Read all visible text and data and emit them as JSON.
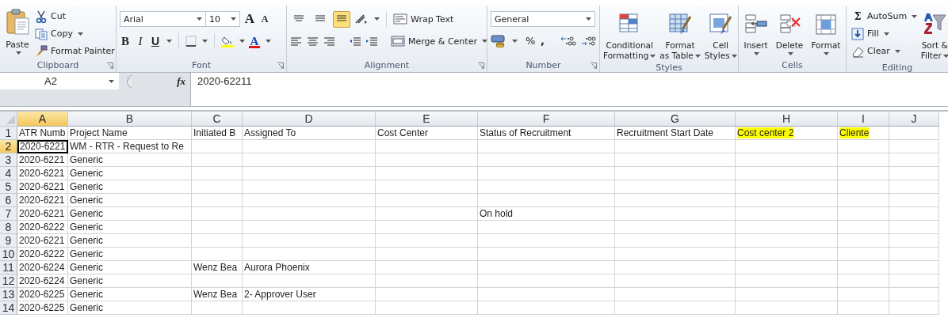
{
  "ribbon": {
    "groups": [
      {
        "kind": "clipboard",
        "label": "Clipboard",
        "launcher": true,
        "paste": "Paste",
        "items": [
          {
            "label": "Cut",
            "dropdown": false
          },
          {
            "label": "Copy",
            "dropdown": true
          },
          {
            "label": "Format Painter",
            "dropdown": false
          }
        ]
      },
      {
        "kind": "font",
        "label": "Font",
        "launcher": true,
        "font_name": "Arial",
        "font_size": "10",
        "grow": "A",
        "shrink": "A",
        "bold": "B",
        "italic": "I",
        "underline": "U",
        "font_color": "A"
      },
      {
        "kind": "alignment",
        "label": "Alignment",
        "launcher": true,
        "top": [
          {
            "selected": false
          },
          {
            "selected": false
          },
          {
            "selected": true
          }
        ],
        "wrap": "Wrap Text",
        "merge": "Merge & Center"
      },
      {
        "kind": "number",
        "label": "Number",
        "launcher": true,
        "format": "General",
        "percent": "%",
        "comma": ","
      },
      {
        "kind": "large",
        "label": "Styles",
        "launcher": false,
        "buttons": [
          {
            "lines": [
              "Conditional",
              "Formatting"
            ],
            "dropdown": true
          },
          {
            "lines": [
              "Format",
              "as Table"
            ],
            "dropdown": true
          },
          {
            "lines": [
              "Cell",
              "Styles"
            ],
            "dropdown": true
          }
        ]
      },
      {
        "kind": "large",
        "label": "Cells",
        "launcher": false,
        "buttons": [
          {
            "lines": [
              "Insert"
            ],
            "dropdown": true
          },
          {
            "lines": [
              "Delete"
            ],
            "dropdown": true
          },
          {
            "lines": [
              "Format"
            ],
            "dropdown": true
          }
        ]
      },
      {
        "kind": "editing",
        "label": "Editing",
        "launcher": false,
        "sigma": "Σ",
        "items": [
          {
            "label": "AutoSum",
            "dropdown": true
          },
          {
            "label": "Fill",
            "dropdown": true
          },
          {
            "label": "Clear",
            "dropdown": true
          }
        ],
        "sort": [
          "Sort &",
          "Filter"
        ]
      }
    ]
  },
  "formula_bar": {
    "name_box": "A2",
    "fx": "fx",
    "formula": "2020-62211"
  },
  "sheet": {
    "columns": [
      {
        "label": "A",
        "selected": true
      },
      {
        "label": "B",
        "selected": false
      },
      {
        "label": "C",
        "selected": false
      },
      {
        "label": "D",
        "selected": false
      },
      {
        "label": "E",
        "selected": false
      },
      {
        "label": "F",
        "selected": false
      },
      {
        "label": "G",
        "selected": false
      },
      {
        "label": "H",
        "selected": false
      },
      {
        "label": "I",
        "selected": false
      },
      {
        "label": "J",
        "selected": false
      }
    ],
    "rows": [
      {
        "number": "1",
        "selected": false,
        "cells": {
          "A": {
            "text": "ATR Numb",
            "highlighted": false
          },
          "B": {
            "text": "Project Name",
            "highlighted": false
          },
          "C": {
            "text": "Initiated B",
            "highlighted": false
          },
          "D": {
            "text": "Assigned To",
            "highlighted": false
          },
          "E": {
            "text": "Cost Center",
            "highlighted": false
          },
          "F": {
            "text": "Status of Recruitment",
            "highlighted": false
          },
          "G": {
            "text": "Recruitment Start Date",
            "highlighted": false
          },
          "H": {
            "text": "Cost center 2",
            "highlighted": true
          },
          "I": {
            "text": "Cliente",
            "highlighted": true
          }
        }
      },
      {
        "number": "2",
        "selected": true,
        "cells": {
          "A": {
            "text": "2020-6221"
          },
          "B": {
            "text": "WM - RTR - Request to Re"
          }
        }
      },
      {
        "number": "3",
        "selected": false,
        "cells": {
          "A": {
            "text": "2020-6221"
          },
          "B": {
            "text": "Generic"
          }
        }
      },
      {
        "number": "4",
        "selected": false,
        "cells": {
          "A": {
            "text": "2020-6221"
          },
          "B": {
            "text": "Generic"
          }
        }
      },
      {
        "number": "5",
        "selected": false,
        "cells": {
          "A": {
            "text": "2020-6221"
          },
          "B": {
            "text": "Generic"
          }
        }
      },
      {
        "number": "6",
        "selected": false,
        "cells": {
          "A": {
            "text": "2020-6221"
          },
          "B": {
            "text": "Generic"
          }
        }
      },
      {
        "number": "7",
        "selected": false,
        "cells": {
          "A": {
            "text": "2020-6221"
          },
          "B": {
            "text": "Generic"
          },
          "F": {
            "text": "On hold"
          }
        }
      },
      {
        "number": "8",
        "selected": false,
        "cells": {
          "A": {
            "text": "2020-6222"
          },
          "B": {
            "text": "Generic"
          }
        }
      },
      {
        "number": "9",
        "selected": false,
        "cells": {
          "A": {
            "text": "2020-6221"
          },
          "B": {
            "text": "Generic"
          }
        }
      },
      {
        "number": "10",
        "selected": false,
        "cells": {
          "A": {
            "text": "2020-6222"
          },
          "B": {
            "text": "Generic"
          }
        }
      },
      {
        "number": "11",
        "selected": false,
        "cells": {
          "A": {
            "text": "2020-6224"
          },
          "B": {
            "text": "Generic"
          },
          "C": {
            "text": "Wenz Bea"
          },
          "D": {
            "text": "Aurora Phoenix"
          }
        }
      },
      {
        "number": "12",
        "selected": false,
        "cells": {
          "A": {
            "text": "2020-6224"
          },
          "B": {
            "text": "Generic"
          }
        }
      },
      {
        "number": "13",
        "selected": false,
        "cells": {
          "A": {
            "text": "2020-6225"
          },
          "B": {
            "text": "Generic"
          },
          "C": {
            "text": "Wenz Bea"
          },
          "D": {
            "text": "2- Approver User"
          }
        }
      },
      {
        "number": "14",
        "selected": false,
        "cells": {
          "A": {
            "text": "2020-6225"
          },
          "B": {
            "text": "Generic"
          }
        }
      }
    ]
  }
}
